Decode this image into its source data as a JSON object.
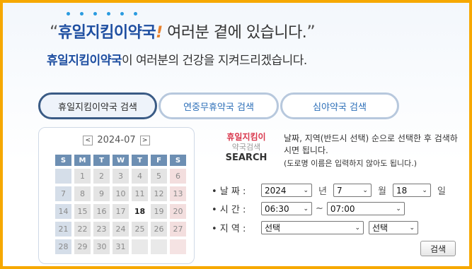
{
  "headline": {
    "quote_open": "“",
    "brand": "휴일지킴이약국",
    "exclaim": "!",
    "rest": " 여러분 곁에 있습니다.",
    "quote_close": "”"
  },
  "subhead": {
    "brand": "휴일지킴이약국",
    "rest": "이 여러분의 건강을 지켜드리겠습니다."
  },
  "tabs": [
    {
      "label": "휴일지킴이약국 검색",
      "active": true
    },
    {
      "label": "연중무휴약국 검색",
      "active": false
    },
    {
      "label": "심야약국 검색",
      "active": false
    }
  ],
  "calendar": {
    "prev": "<",
    "next": ">",
    "month": "2024-07",
    "weekdays": [
      "S",
      "M",
      "T",
      "W",
      "T",
      "F",
      "S"
    ],
    "weeks": [
      [
        "",
        "1",
        "2",
        "3",
        "4",
        "5",
        "6"
      ],
      [
        "7",
        "8",
        "9",
        "10",
        "11",
        "12",
        "13"
      ],
      [
        "14",
        "15",
        "16",
        "17",
        "18",
        "19",
        "20"
      ],
      [
        "21",
        "22",
        "23",
        "24",
        "25",
        "26",
        "27"
      ],
      [
        "28",
        "29",
        "30",
        "31",
        "",
        "",
        ""
      ]
    ],
    "today": "18"
  },
  "search_logo": {
    "line1": "휴일지킴이",
    "line2": "약국검색",
    "line3": "SEARCH"
  },
  "guide": {
    "text": "날짜, 지역(반드시 선택) 순으로 선택한 후 검색하시면 됩니다.",
    "note": "(도로명 이름은 입력하지 않아도 됩니다.)"
  },
  "form": {
    "date_label": "• 날 짜 :",
    "year": "2024",
    "year_unit": "년",
    "month": "7",
    "month_unit": "월",
    "day": "18",
    "day_unit": "일",
    "time_label": "• 시 간 :",
    "time_from": "06:30",
    "time_sep": "~",
    "time_to": "07:00",
    "area_label": "• 지 역 :",
    "area1": "선택",
    "area2": "선택",
    "chevron": "⌄",
    "search_button": "검색"
  },
  "colors": {
    "frame": "#f6a800",
    "brand_blue": "#1f4fa1",
    "accent_red": "#d9364b"
  }
}
